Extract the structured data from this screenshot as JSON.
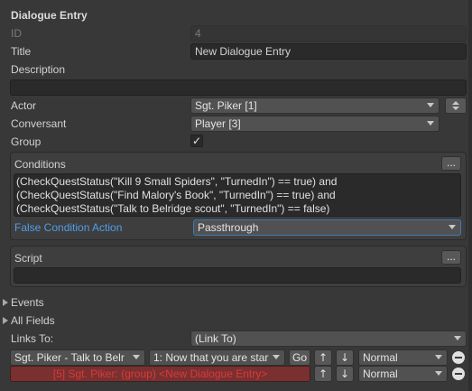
{
  "header": {
    "title": "Dialogue Entry"
  },
  "fields": {
    "id": {
      "label": "ID",
      "value": "4"
    },
    "title": {
      "label": "Title",
      "value": "New Dialogue Entry"
    },
    "description": {
      "label": "Description",
      "value": ""
    },
    "actor": {
      "label": "Actor",
      "value": "Sgt. Piker [1]"
    },
    "conversant": {
      "label": "Conversant",
      "value": "Player [3]"
    },
    "group": {
      "label": "Group",
      "checked": true,
      "check_glyph": "✓"
    }
  },
  "conditions": {
    "label": "Conditions",
    "menu_button": "...",
    "lines": [
      "(CheckQuestStatus(\"Kill 9 Small Spiders\", \"TurnedIn\")  == true) and",
      "(CheckQuestStatus(\"Find Malory's Book\", \"TurnedIn\")  == true) and",
      "(CheckQuestStatus(\"Talk to Belridge scout\", \"TurnedIn\") == false)"
    ],
    "false_action_label": "False Condition Action",
    "false_action_value": "Passthrough"
  },
  "script": {
    "label": "Script",
    "menu_button": "...",
    "value": ""
  },
  "foldouts": {
    "events": "Events",
    "all_fields": "All Fields"
  },
  "links": {
    "label": "Links To:",
    "link_to_value": "(Link To)",
    "row1": {
      "target": "Sgt. Piker - Talk to Belr",
      "entry": "1: Now that you are star",
      "go": "Go",
      "up": "↑",
      "down": "↓",
      "priority": "Normal"
    },
    "row2": {
      "target": "[5] Sgt. Piker: (group) <New Dialogue Entry>",
      "up": "↑",
      "down": "↓",
      "priority": "Normal"
    }
  },
  "colors": {
    "background": "#383838",
    "accent_label": "#4f9eea",
    "warning_text": "#d93a3a",
    "warning_bg": "#7a3030"
  }
}
